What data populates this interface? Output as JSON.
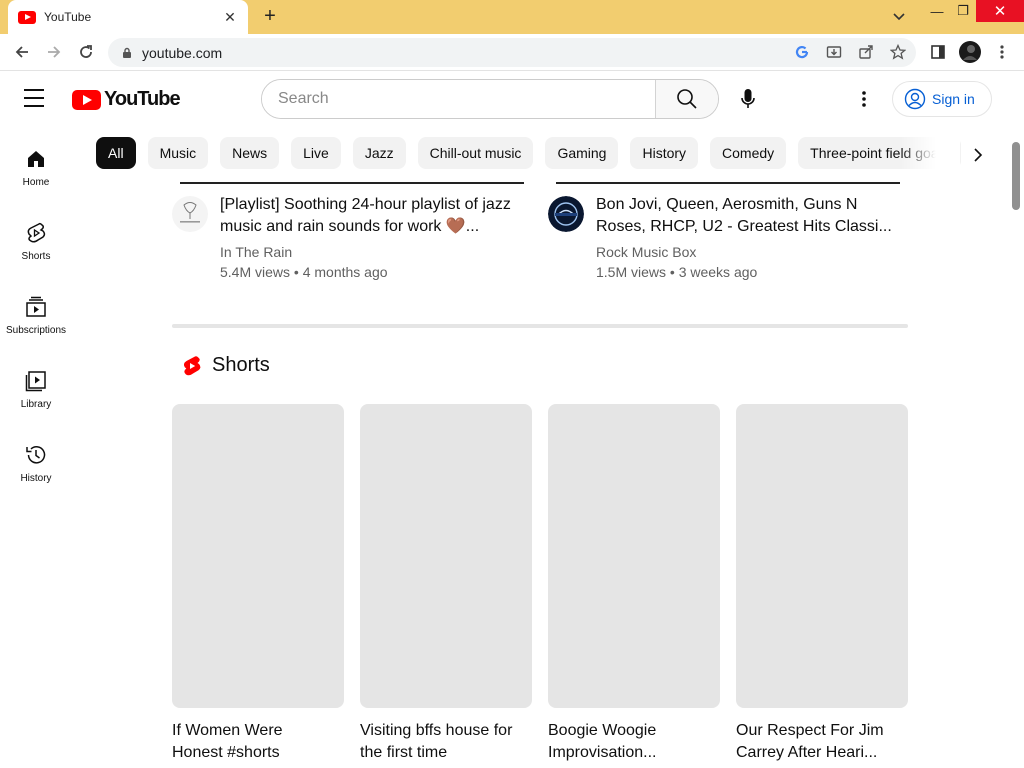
{
  "browser": {
    "tab_title": "YouTube",
    "tab_close": "✕",
    "new_tab": "+",
    "url": "youtube.com",
    "window": {
      "dropdown": "⌄",
      "minimize": "—",
      "restore": "❐",
      "close": "✕"
    }
  },
  "header": {
    "logo_text": "YouTube",
    "search_placeholder": "Search",
    "sign_in_label": "Sign in"
  },
  "sidebar": {
    "items": [
      {
        "label": "Home",
        "icon": "home-icon"
      },
      {
        "label": "Shorts",
        "icon": "shorts-icon"
      },
      {
        "label": "Subscriptions",
        "icon": "subscriptions-icon"
      },
      {
        "label": "Library",
        "icon": "library-icon"
      },
      {
        "label": "History",
        "icon": "history-icon"
      }
    ]
  },
  "chips": [
    "All",
    "Music",
    "News",
    "Live",
    "Jazz",
    "Chill-out music",
    "Gaming",
    "History",
    "Comedy",
    "Three-point field goals"
  ],
  "videos": [
    {
      "title": "[Playlist] Soothing 24-hour playlist of jazz music and rain sounds for work 🤎...",
      "channel": "In The Rain",
      "meta": "5.4M views • 4 months ago"
    },
    {
      "title": "Bon Jovi, Queen, Aerosmith, Guns N Roses, RHCP, U2 - Greatest Hits Classi...",
      "channel": "Rock Music Box",
      "meta": "1.5M views • 3 weeks ago"
    }
  ],
  "shorts": {
    "heading": "Shorts",
    "items": [
      {
        "title": "If Women Were Honest #shorts"
      },
      {
        "title": "Visiting bffs house for the first time"
      },
      {
        "title": "Boogie Woogie Improvisation..."
      },
      {
        "title": "Our Respect For Jim Carrey After Heari..."
      }
    ]
  },
  "colors": {
    "accent_red": "#ff0000",
    "link_blue": "#065fd4",
    "tabstrip": "#f2cd6f"
  }
}
